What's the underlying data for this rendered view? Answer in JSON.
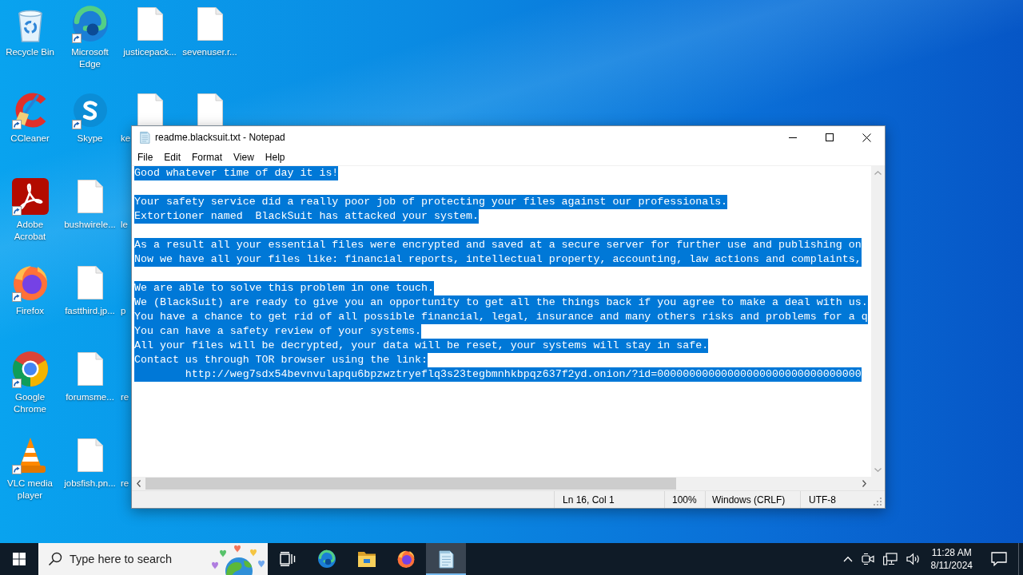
{
  "desktop": {
    "icons": [
      {
        "kind": "recycle-bin",
        "label": "Recycle Bin",
        "shortcut": false
      },
      {
        "kind": "ccleaner",
        "label": "CCleaner",
        "shortcut": true
      },
      {
        "kind": "acrobat",
        "label": "Adobe Acrobat",
        "shortcut": true
      },
      {
        "kind": "firefox",
        "label": "Firefox",
        "shortcut": true
      },
      {
        "kind": "chrome",
        "label": "Google Chrome",
        "shortcut": true
      },
      {
        "kind": "vlc",
        "label": "VLC media player",
        "shortcut": true
      },
      {
        "kind": "edge",
        "label": "Microsoft Edge",
        "shortcut": true
      },
      {
        "kind": "skype",
        "label": "Skype",
        "shortcut": true
      },
      {
        "kind": "file",
        "label": "bushwirele...",
        "shortcut": false
      },
      {
        "kind": "file",
        "label": "fastthird.jp...",
        "shortcut": false
      },
      {
        "kind": "file",
        "label": "forumsme...",
        "shortcut": false
      },
      {
        "kind": "file",
        "label": "jobsfish.pn...",
        "shortcut": false
      },
      {
        "kind": "file",
        "label": "justicepack...",
        "shortcut": false
      },
      {
        "kind": "file",
        "label": "ke",
        "shortcut": false
      },
      {
        "label": "le"
      },
      {
        "label": "p"
      },
      {
        "label": "re"
      },
      {
        "label": "re"
      },
      {
        "kind": "file",
        "label": "sevenuser.r...",
        "shortcut": false
      },
      {
        "kind": "file",
        "shortcut": false
      }
    ]
  },
  "notepad": {
    "title": "readme.blacksuit.txt - Notepad",
    "menu": [
      "File",
      "Edit",
      "Format",
      "View",
      "Help"
    ],
    "paragraphs": [
      [
        {
          "text": "Good whatever time of day it is!",
          "selected": true
        }
      ],
      [
        {
          "text": "Your safety service did a really poor job of protecting your files against our professionals.",
          "selected": true
        },
        {
          "text": "Extortioner named  BlackSuit has attacked your system.",
          "selected": true
        }
      ],
      [
        {
          "text": "As a result all your essential files were encrypted and saved at a secure server for further use and publishing on",
          "selected": true
        },
        {
          "text": "Now we have all your files like: financial reports, intellectual property, accounting, law actions and complaints,",
          "selected": true
        }
      ],
      [
        {
          "text": "We are able to solve this problem in one touch.",
          "selected": true
        },
        {
          "text": "We (BlackSuit) are ready to give you an opportunity to get all the things back if you agree to make a deal with us.",
          "selected": true
        },
        {
          "text": "You have a chance to get rid of all possible financial, legal, insurance and many others risks and problems for a q",
          "selected": true
        },
        {
          "text": "You can have a safety review of your systems.",
          "selected": true
        },
        {
          "text": "All your files will be decrypted, your data will be reset, your systems will stay in safe.",
          "selected": true
        },
        {
          "text": "Contact us through TOR browser using the link:",
          "selected": true
        },
        {
          "text": "\thttp://weg7sdx54bevnvulapqu6bpzwztryeflq3s23tegbmnhkbpqz637f2yd.onion/?id=00000000000000000000000000000000",
          "selected": true
        }
      ]
    ],
    "status_bar": [
      "Ln 16, Col 1",
      "100%",
      "Windows (CRLF)",
      "UTF-8"
    ]
  },
  "taskbar": {
    "search": {
      "placeholder": "Type here to search"
    },
    "apps": [
      {
        "kind": "task-view",
        "active": false
      },
      {
        "kind": "edge",
        "active": false
      },
      {
        "kind": "file-explorer",
        "active": false
      },
      {
        "kind": "firefox",
        "active": false
      },
      {
        "kind": "notepad",
        "active": true
      }
    ],
    "clock": {
      "time": "11:28 AM",
      "date": "8/11/2024"
    }
  }
}
